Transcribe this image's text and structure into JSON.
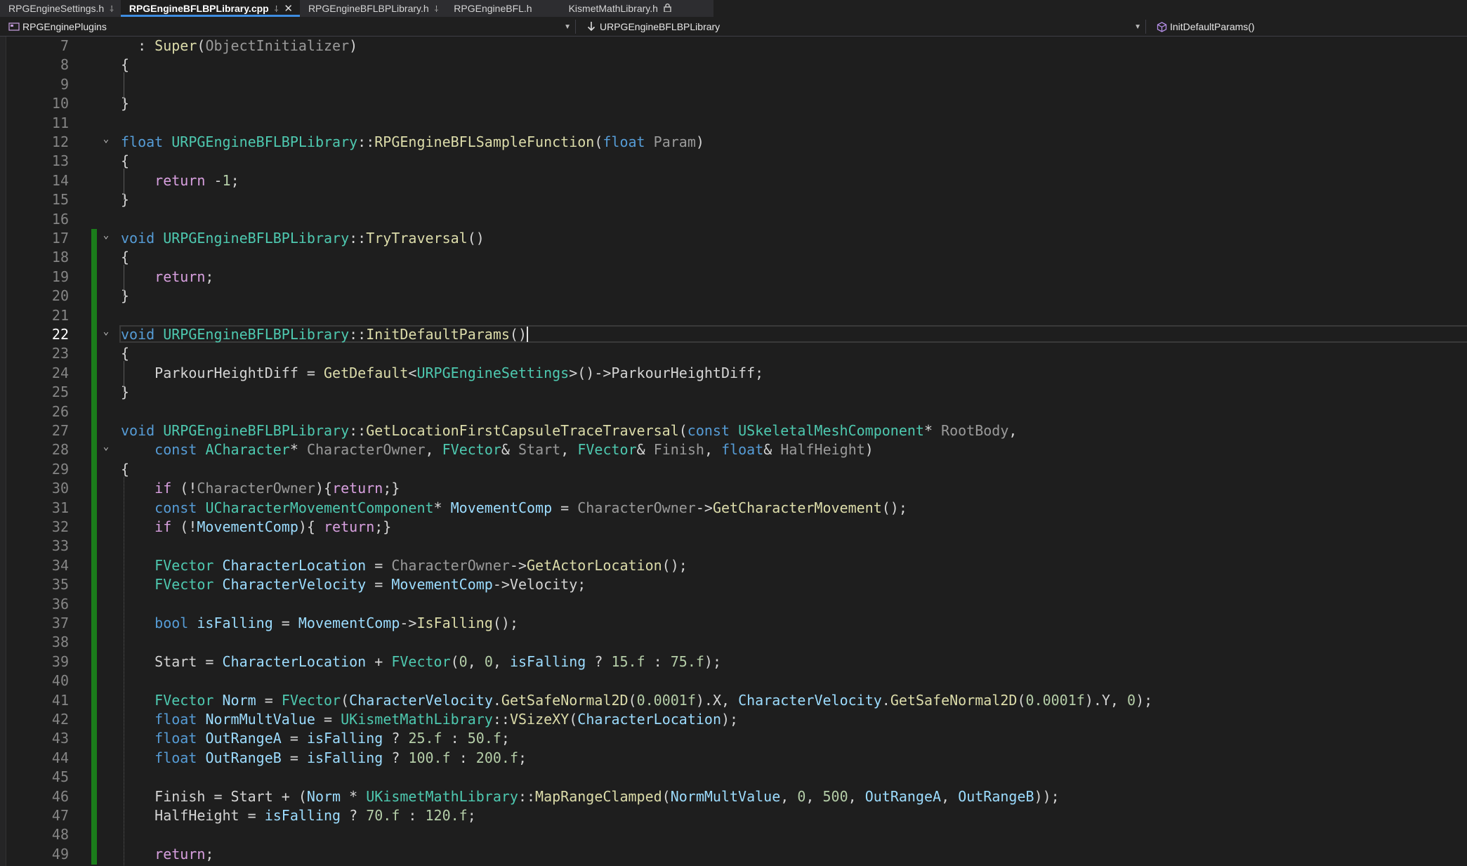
{
  "tabs": [
    {
      "label": "RPGEngineSettings.h",
      "icon": "pin-icon"
    },
    {
      "label": "RPGEngineBFLBPLibrary.cpp",
      "icon": "pin-icon",
      "active": true,
      "close_icon": "close-icon"
    },
    {
      "label": "RPGEngineBFLBPLibrary.h",
      "icon": "pin-icon"
    },
    {
      "label": "RPGEngineBFL.h"
    },
    {
      "label": "KismetMathLibrary.h",
      "icon": "lock-icon"
    }
  ],
  "nav": {
    "project": "RPGEnginePlugins",
    "scope": "URPGEngineBFLBPLibrary",
    "member": "InitDefaultParams()"
  },
  "colors": {
    "keyword": "#569cd6",
    "control": "#d8a0df",
    "type": "#4ec9b0",
    "function": "#dcdcaa",
    "variable": "#9cdcfe",
    "parameter": "#9a9a9a",
    "number": "#b5cea8",
    "text": "#d4d4d4",
    "change_bar": "#1b7d1b",
    "active_tab_accent": "#3e8ce0"
  },
  "editor": {
    "current_line": "22",
    "lines": [
      {
        "n": "7",
        "tokens": [
          [
            "t",
            "  : "
          ],
          [
            "fn",
            "Super"
          ],
          [
            "t",
            "("
          ],
          [
            "par",
            "ObjectInitializer"
          ],
          [
            "t",
            ")"
          ]
        ]
      },
      {
        "n": "8",
        "tokens": [
          [
            "t",
            "{"
          ]
        ]
      },
      {
        "n": "9",
        "tokens": []
      },
      {
        "n": "10",
        "tokens": [
          [
            "t",
            "}"
          ]
        ]
      },
      {
        "n": "11",
        "tokens": []
      },
      {
        "n": "12",
        "fold": true,
        "tokens": [
          [
            "kw",
            "float"
          ],
          [
            "t",
            " "
          ],
          [
            "type",
            "URPGEngineBFLBPLibrary"
          ],
          [
            "t",
            "::"
          ],
          [
            "fn",
            "RPGEngineBFLSampleFunction"
          ],
          [
            "t",
            "("
          ],
          [
            "kw",
            "float"
          ],
          [
            "t",
            " "
          ],
          [
            "par",
            "Param"
          ],
          [
            "t",
            ")"
          ]
        ]
      },
      {
        "n": "13",
        "tokens": [
          [
            "t",
            "{"
          ]
        ]
      },
      {
        "n": "14",
        "tokens": [
          [
            "t",
            "    "
          ],
          [
            "ctl",
            "return"
          ],
          [
            "t",
            " -"
          ],
          [
            "num",
            "1"
          ],
          [
            "t",
            ";"
          ]
        ]
      },
      {
        "n": "15",
        "tokens": [
          [
            "t",
            "}"
          ]
        ]
      },
      {
        "n": "16",
        "tokens": []
      },
      {
        "n": "17",
        "fold": true,
        "changed": true,
        "tokens": [
          [
            "kw",
            "void"
          ],
          [
            "t",
            " "
          ],
          [
            "type",
            "URPGEngineBFLBPLibrary"
          ],
          [
            "t",
            "::"
          ],
          [
            "fn",
            "TryTraversal"
          ],
          [
            "t",
            "()"
          ]
        ]
      },
      {
        "n": "18",
        "changed": true,
        "tokens": [
          [
            "t",
            "{"
          ]
        ]
      },
      {
        "n": "19",
        "changed": true,
        "tokens": [
          [
            "t",
            "    "
          ],
          [
            "ctl",
            "return"
          ],
          [
            "t",
            ";"
          ]
        ]
      },
      {
        "n": "20",
        "changed": true,
        "tokens": [
          [
            "t",
            "}"
          ]
        ]
      },
      {
        "n": "21",
        "changed": true,
        "tokens": []
      },
      {
        "n": "22",
        "fold": true,
        "changed": true,
        "current": true,
        "tokens": [
          [
            "kw",
            "void"
          ],
          [
            "t",
            " "
          ],
          [
            "type",
            "URPGEngineBFLBPLibrary"
          ],
          [
            "t",
            "::"
          ],
          [
            "fn",
            "InitDefaultParams"
          ],
          [
            "t",
            "()"
          ]
        ]
      },
      {
        "n": "23",
        "changed": true,
        "tokens": [
          [
            "t",
            "{"
          ]
        ]
      },
      {
        "n": "24",
        "changed": true,
        "tokens": [
          [
            "t",
            "    ParkourHeightDiff = "
          ],
          [
            "fn",
            "GetDefault"
          ],
          [
            "t",
            "<"
          ],
          [
            "type",
            "URPGEngineSettings"
          ],
          [
            "t",
            ">()->"
          ],
          [
            "t",
            "ParkourHeightDiff;"
          ]
        ]
      },
      {
        "n": "25",
        "changed": true,
        "tokens": [
          [
            "t",
            "}"
          ]
        ]
      },
      {
        "n": "26",
        "changed": true,
        "tokens": []
      },
      {
        "n": "27",
        "changed": true,
        "tokens": [
          [
            "kw",
            "void"
          ],
          [
            "t",
            " "
          ],
          [
            "type",
            "URPGEngineBFLBPLibrary"
          ],
          [
            "t",
            "::"
          ],
          [
            "fn",
            "GetLocationFirstCapsuleTraceTraversal"
          ],
          [
            "t",
            "("
          ],
          [
            "kw",
            "const"
          ],
          [
            "t",
            " "
          ],
          [
            "type",
            "USkeletalMeshComponent"
          ],
          [
            "t",
            "* "
          ],
          [
            "par",
            "RootBody"
          ],
          [
            "t",
            ","
          ]
        ]
      },
      {
        "n": "28",
        "fold": true,
        "changed": true,
        "tokens": [
          [
            "t",
            "    "
          ],
          [
            "kw",
            "const"
          ],
          [
            "t",
            " "
          ],
          [
            "type",
            "ACharacter"
          ],
          [
            "t",
            "* "
          ],
          [
            "par",
            "CharacterOwner"
          ],
          [
            "t",
            ", "
          ],
          [
            "type",
            "FVector"
          ],
          [
            "t",
            "& "
          ],
          [
            "par",
            "Start"
          ],
          [
            "t",
            ", "
          ],
          [
            "type",
            "FVector"
          ],
          [
            "t",
            "& "
          ],
          [
            "par",
            "Finish"
          ],
          [
            "t",
            ", "
          ],
          [
            "kw",
            "float"
          ],
          [
            "t",
            "& "
          ],
          [
            "par",
            "HalfHeight"
          ],
          [
            "t",
            ")"
          ]
        ]
      },
      {
        "n": "29",
        "changed": true,
        "tokens": [
          [
            "t",
            "{"
          ]
        ]
      },
      {
        "n": "30",
        "changed": true,
        "tokens": [
          [
            "t",
            "    "
          ],
          [
            "ctl",
            "if"
          ],
          [
            "t",
            " (!"
          ],
          [
            "par",
            "CharacterOwner"
          ],
          [
            "t",
            "){"
          ],
          [
            "ctl",
            "return"
          ],
          [
            "t",
            ";}"
          ]
        ]
      },
      {
        "n": "31",
        "changed": true,
        "tokens": [
          [
            "t",
            "    "
          ],
          [
            "kw",
            "const"
          ],
          [
            "t",
            " "
          ],
          [
            "type",
            "UCharacterMovementComponent"
          ],
          [
            "t",
            "* "
          ],
          [
            "var",
            "MovementComp"
          ],
          [
            "t",
            " = "
          ],
          [
            "par",
            "CharacterOwner"
          ],
          [
            "t",
            "->"
          ],
          [
            "fn",
            "GetCharacterMovement"
          ],
          [
            "t",
            "();"
          ]
        ]
      },
      {
        "n": "32",
        "changed": true,
        "tokens": [
          [
            "t",
            "    "
          ],
          [
            "ctl",
            "if"
          ],
          [
            "t",
            " (!"
          ],
          [
            "var",
            "MovementComp"
          ],
          [
            "t",
            "){ "
          ],
          [
            "ctl",
            "return"
          ],
          [
            "t",
            ";}"
          ]
        ]
      },
      {
        "n": "33",
        "changed": true,
        "tokens": []
      },
      {
        "n": "34",
        "changed": true,
        "tokens": [
          [
            "t",
            "    "
          ],
          [
            "type",
            "FVector"
          ],
          [
            "t",
            " "
          ],
          [
            "var",
            "CharacterLocation"
          ],
          [
            "t",
            " = "
          ],
          [
            "par",
            "CharacterOwner"
          ],
          [
            "t",
            "->"
          ],
          [
            "fn",
            "GetActorLocation"
          ],
          [
            "t",
            "();"
          ]
        ]
      },
      {
        "n": "35",
        "changed": true,
        "tokens": [
          [
            "t",
            "    "
          ],
          [
            "type",
            "FVector"
          ],
          [
            "t",
            " "
          ],
          [
            "var",
            "CharacterVelocity"
          ],
          [
            "t",
            " = "
          ],
          [
            "var",
            "MovementComp"
          ],
          [
            "t",
            "->Velocity;"
          ]
        ]
      },
      {
        "n": "36",
        "changed": true,
        "tokens": []
      },
      {
        "n": "37",
        "changed": true,
        "tokens": [
          [
            "t",
            "    "
          ],
          [
            "kw",
            "bool"
          ],
          [
            "t",
            " "
          ],
          [
            "var",
            "isFalling"
          ],
          [
            "t",
            " = "
          ],
          [
            "var",
            "MovementComp"
          ],
          [
            "t",
            "->"
          ],
          [
            "fn",
            "IsFalling"
          ],
          [
            "t",
            "();"
          ]
        ]
      },
      {
        "n": "38",
        "changed": true,
        "tokens": []
      },
      {
        "n": "39",
        "changed": true,
        "tokens": [
          [
            "t",
            "    Start = "
          ],
          [
            "var",
            "CharacterLocation"
          ],
          [
            "t",
            " + "
          ],
          [
            "type",
            "FVector"
          ],
          [
            "t",
            "("
          ],
          [
            "num",
            "0"
          ],
          [
            "t",
            ", "
          ],
          [
            "num",
            "0"
          ],
          [
            "t",
            ", "
          ],
          [
            "var",
            "isFalling"
          ],
          [
            "t",
            " ? "
          ],
          [
            "num",
            "15.f"
          ],
          [
            "t",
            " : "
          ],
          [
            "num",
            "75.f"
          ],
          [
            "t",
            ");"
          ]
        ]
      },
      {
        "n": "40",
        "changed": true,
        "tokens": []
      },
      {
        "n": "41",
        "changed": true,
        "tokens": [
          [
            "t",
            "    "
          ],
          [
            "type",
            "FVector"
          ],
          [
            "t",
            " "
          ],
          [
            "var",
            "Norm"
          ],
          [
            "t",
            " = "
          ],
          [
            "type",
            "FVector"
          ],
          [
            "t",
            "("
          ],
          [
            "var",
            "CharacterVelocity"
          ],
          [
            "t",
            "."
          ],
          [
            "fn",
            "GetSafeNormal2D"
          ],
          [
            "t",
            "("
          ],
          [
            "num",
            "0.0001f"
          ],
          [
            "t",
            ").X, "
          ],
          [
            "var",
            "CharacterVelocity"
          ],
          [
            "t",
            "."
          ],
          [
            "fn",
            "GetSafeNormal2D"
          ],
          [
            "t",
            "("
          ],
          [
            "num",
            "0.0001f"
          ],
          [
            "t",
            ").Y, "
          ],
          [
            "num",
            "0"
          ],
          [
            "t",
            ");"
          ]
        ]
      },
      {
        "n": "42",
        "changed": true,
        "tokens": [
          [
            "t",
            "    "
          ],
          [
            "kw",
            "float"
          ],
          [
            "t",
            " "
          ],
          [
            "var",
            "NormMultValue"
          ],
          [
            "t",
            " = "
          ],
          [
            "type",
            "UKismetMathLibrary"
          ],
          [
            "t",
            "::"
          ],
          [
            "fn",
            "VSizeXY"
          ],
          [
            "t",
            "("
          ],
          [
            "var",
            "CharacterLocation"
          ],
          [
            "t",
            ");"
          ]
        ]
      },
      {
        "n": "43",
        "changed": true,
        "tokens": [
          [
            "t",
            "    "
          ],
          [
            "kw",
            "float"
          ],
          [
            "t",
            " "
          ],
          [
            "var",
            "OutRangeA"
          ],
          [
            "t",
            " = "
          ],
          [
            "var",
            "isFalling"
          ],
          [
            "t",
            " ? "
          ],
          [
            "num",
            "25.f"
          ],
          [
            "t",
            " : "
          ],
          [
            "num",
            "50.f"
          ],
          [
            "t",
            ";"
          ]
        ]
      },
      {
        "n": "44",
        "changed": true,
        "tokens": [
          [
            "t",
            "    "
          ],
          [
            "kw",
            "float"
          ],
          [
            "t",
            " "
          ],
          [
            "var",
            "OutRangeB"
          ],
          [
            "t",
            " = "
          ],
          [
            "var",
            "isFalling"
          ],
          [
            "t",
            " ? "
          ],
          [
            "num",
            "100.f"
          ],
          [
            "t",
            " : "
          ],
          [
            "num",
            "200.f"
          ],
          [
            "t",
            ";"
          ]
        ]
      },
      {
        "n": "45",
        "changed": true,
        "tokens": []
      },
      {
        "n": "46",
        "changed": true,
        "tokens": [
          [
            "t",
            "    Finish = Start + ("
          ],
          [
            "var",
            "Norm"
          ],
          [
            "t",
            " * "
          ],
          [
            "type",
            "UKismetMathLibrary"
          ],
          [
            "t",
            "::"
          ],
          [
            "fn",
            "MapRangeClamped"
          ],
          [
            "t",
            "("
          ],
          [
            "var",
            "NormMultValue"
          ],
          [
            "t",
            ", "
          ],
          [
            "num",
            "0"
          ],
          [
            "t",
            ", "
          ],
          [
            "num",
            "500"
          ],
          [
            "t",
            ", "
          ],
          [
            "var",
            "OutRangeA"
          ],
          [
            "t",
            ", "
          ],
          [
            "var",
            "OutRangeB"
          ],
          [
            "t",
            "));"
          ]
        ]
      },
      {
        "n": "47",
        "changed": true,
        "tokens": [
          [
            "t",
            "    HalfHeight = "
          ],
          [
            "var",
            "isFalling"
          ],
          [
            "t",
            " ? "
          ],
          [
            "num",
            "70.f"
          ],
          [
            "t",
            " : "
          ],
          [
            "num",
            "120.f"
          ],
          [
            "t",
            ";"
          ]
        ]
      },
      {
        "n": "48",
        "changed": true,
        "tokens": []
      },
      {
        "n": "49",
        "changed": true,
        "tokens": [
          [
            "t",
            "    "
          ],
          [
            "ctl",
            "return"
          ],
          [
            "t",
            ";"
          ]
        ]
      }
    ]
  }
}
